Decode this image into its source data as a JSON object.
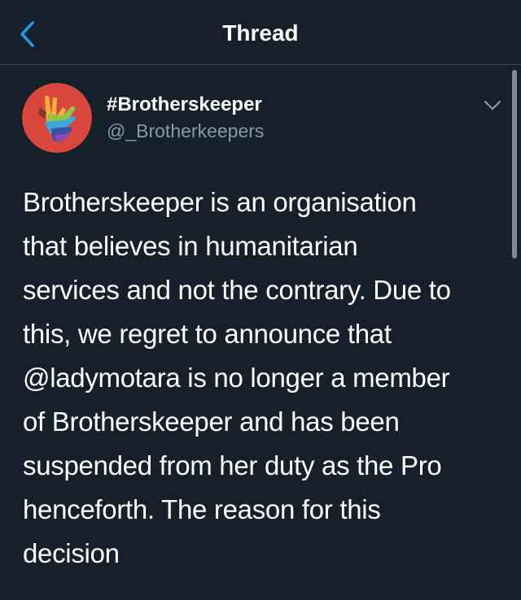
{
  "header": {
    "title": "Thread",
    "back_icon": "chevron-left-icon"
  },
  "tweet": {
    "display_name": "#Brotherskeeper",
    "handle": "@_Brotherkeepers",
    "menu_icon": "chevron-down-icon",
    "text_lines": [
      "Brotherskeeper is an organisation",
      "that believes in humanitarian",
      "services and not the contrary. Due to",
      "this, we regret to announce that",
      "@ladymotara is no longer a member",
      "of Brotherskeeper and has been",
      "suspended from her duty as the Pro",
      "henceforth. The reason for this",
      "decision"
    ]
  },
  "colors": {
    "background": "#15202b",
    "accent": "#1da1f2",
    "secondary_text": "#8899a6",
    "divider": "#38444d"
  }
}
